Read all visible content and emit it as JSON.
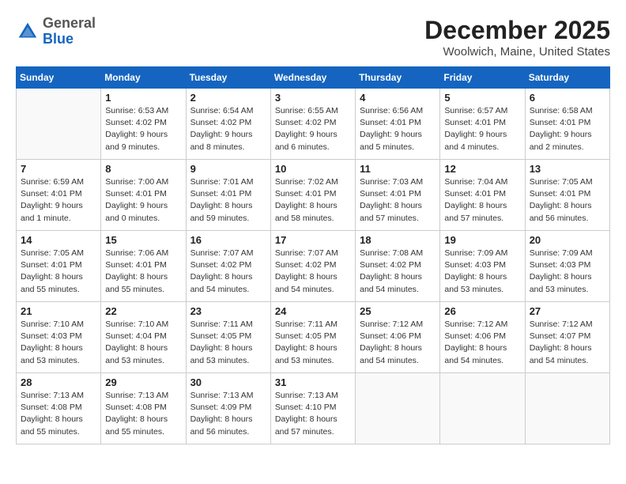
{
  "header": {
    "logo": {
      "general": "General",
      "blue": "Blue"
    },
    "title": "December 2025",
    "location": "Woolwich, Maine, United States"
  },
  "weekdays": [
    "Sunday",
    "Monday",
    "Tuesday",
    "Wednesday",
    "Thursday",
    "Friday",
    "Saturday"
  ],
  "weeks": [
    [
      {
        "day": "",
        "info": ""
      },
      {
        "day": "1",
        "info": "Sunrise: 6:53 AM\nSunset: 4:02 PM\nDaylight: 9 hours\nand 9 minutes."
      },
      {
        "day": "2",
        "info": "Sunrise: 6:54 AM\nSunset: 4:02 PM\nDaylight: 9 hours\nand 8 minutes."
      },
      {
        "day": "3",
        "info": "Sunrise: 6:55 AM\nSunset: 4:02 PM\nDaylight: 9 hours\nand 6 minutes."
      },
      {
        "day": "4",
        "info": "Sunrise: 6:56 AM\nSunset: 4:01 PM\nDaylight: 9 hours\nand 5 minutes."
      },
      {
        "day": "5",
        "info": "Sunrise: 6:57 AM\nSunset: 4:01 PM\nDaylight: 9 hours\nand 4 minutes."
      },
      {
        "day": "6",
        "info": "Sunrise: 6:58 AM\nSunset: 4:01 PM\nDaylight: 9 hours\nand 2 minutes."
      }
    ],
    [
      {
        "day": "7",
        "info": "Sunrise: 6:59 AM\nSunset: 4:01 PM\nDaylight: 9 hours\nand 1 minute."
      },
      {
        "day": "8",
        "info": "Sunrise: 7:00 AM\nSunset: 4:01 PM\nDaylight: 9 hours\nand 0 minutes."
      },
      {
        "day": "9",
        "info": "Sunrise: 7:01 AM\nSunset: 4:01 PM\nDaylight: 8 hours\nand 59 minutes."
      },
      {
        "day": "10",
        "info": "Sunrise: 7:02 AM\nSunset: 4:01 PM\nDaylight: 8 hours\nand 58 minutes."
      },
      {
        "day": "11",
        "info": "Sunrise: 7:03 AM\nSunset: 4:01 PM\nDaylight: 8 hours\nand 57 minutes."
      },
      {
        "day": "12",
        "info": "Sunrise: 7:04 AM\nSunset: 4:01 PM\nDaylight: 8 hours\nand 57 minutes."
      },
      {
        "day": "13",
        "info": "Sunrise: 7:05 AM\nSunset: 4:01 PM\nDaylight: 8 hours\nand 56 minutes."
      }
    ],
    [
      {
        "day": "14",
        "info": "Sunrise: 7:05 AM\nSunset: 4:01 PM\nDaylight: 8 hours\nand 55 minutes."
      },
      {
        "day": "15",
        "info": "Sunrise: 7:06 AM\nSunset: 4:01 PM\nDaylight: 8 hours\nand 55 minutes."
      },
      {
        "day": "16",
        "info": "Sunrise: 7:07 AM\nSunset: 4:02 PM\nDaylight: 8 hours\nand 54 minutes."
      },
      {
        "day": "17",
        "info": "Sunrise: 7:07 AM\nSunset: 4:02 PM\nDaylight: 8 hours\nand 54 minutes."
      },
      {
        "day": "18",
        "info": "Sunrise: 7:08 AM\nSunset: 4:02 PM\nDaylight: 8 hours\nand 54 minutes."
      },
      {
        "day": "19",
        "info": "Sunrise: 7:09 AM\nSunset: 4:03 PM\nDaylight: 8 hours\nand 53 minutes."
      },
      {
        "day": "20",
        "info": "Sunrise: 7:09 AM\nSunset: 4:03 PM\nDaylight: 8 hours\nand 53 minutes."
      }
    ],
    [
      {
        "day": "21",
        "info": "Sunrise: 7:10 AM\nSunset: 4:03 PM\nDaylight: 8 hours\nand 53 minutes."
      },
      {
        "day": "22",
        "info": "Sunrise: 7:10 AM\nSunset: 4:04 PM\nDaylight: 8 hours\nand 53 minutes."
      },
      {
        "day": "23",
        "info": "Sunrise: 7:11 AM\nSunset: 4:05 PM\nDaylight: 8 hours\nand 53 minutes."
      },
      {
        "day": "24",
        "info": "Sunrise: 7:11 AM\nSunset: 4:05 PM\nDaylight: 8 hours\nand 53 minutes."
      },
      {
        "day": "25",
        "info": "Sunrise: 7:12 AM\nSunset: 4:06 PM\nDaylight: 8 hours\nand 54 minutes."
      },
      {
        "day": "26",
        "info": "Sunrise: 7:12 AM\nSunset: 4:06 PM\nDaylight: 8 hours\nand 54 minutes."
      },
      {
        "day": "27",
        "info": "Sunrise: 7:12 AM\nSunset: 4:07 PM\nDaylight: 8 hours\nand 54 minutes."
      }
    ],
    [
      {
        "day": "28",
        "info": "Sunrise: 7:13 AM\nSunset: 4:08 PM\nDaylight: 8 hours\nand 55 minutes."
      },
      {
        "day": "29",
        "info": "Sunrise: 7:13 AM\nSunset: 4:08 PM\nDaylight: 8 hours\nand 55 minutes."
      },
      {
        "day": "30",
        "info": "Sunrise: 7:13 AM\nSunset: 4:09 PM\nDaylight: 8 hours\nand 56 minutes."
      },
      {
        "day": "31",
        "info": "Sunrise: 7:13 AM\nSunset: 4:10 PM\nDaylight: 8 hours\nand 57 minutes."
      },
      {
        "day": "",
        "info": ""
      },
      {
        "day": "",
        "info": ""
      },
      {
        "day": "",
        "info": ""
      }
    ]
  ]
}
